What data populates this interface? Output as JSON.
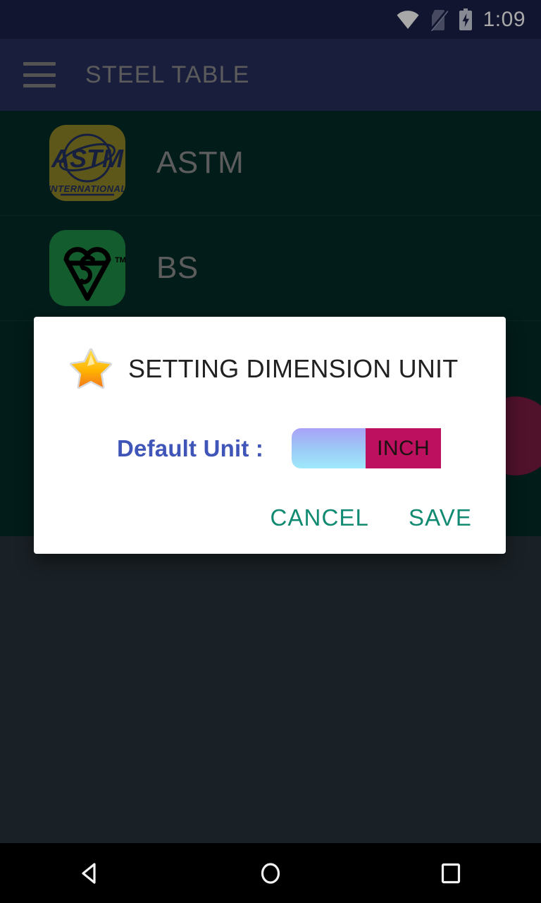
{
  "status_bar": {
    "time": "1:09",
    "icons": [
      {
        "name": "wifi-icon",
        "label": "wifi"
      },
      {
        "name": "no-sim-icon",
        "label": "no-sim"
      },
      {
        "name": "battery-charging-icon",
        "label": "battery-charging"
      }
    ],
    "background_color": "#1b2048"
  },
  "app_bar": {
    "menu_icon": "hamburger-menu-icon",
    "title": "STEEL TABLE",
    "background_color": "#262e5c",
    "title_color": "#8a8a8a"
  },
  "list": {
    "background_color": "#042b28",
    "items": [
      {
        "label": "ASTM",
        "logo_name": "astm-international-logo",
        "logo_text": "ASTM",
        "logo_subtext": "INTERNATIONAL",
        "logo_color": "#8e8426"
      },
      {
        "label": "BS",
        "logo_name": "bsi-kitemark-logo",
        "logo_text": "",
        "logo_subtext": "TM",
        "logo_color": "#1e8c46"
      }
    ]
  },
  "fab": {
    "name": "floating-action-button",
    "color": "#7a1c42"
  },
  "dialog": {
    "icon": "star-icon",
    "title": "SETTING DIMENSION UNIT",
    "field": {
      "label": "Default Unit :",
      "switch_name": "default-unit-toggle",
      "value": "INCH",
      "on_color": "#bd1160",
      "off_color": "#a9a2f7"
    },
    "buttons": {
      "cancel": "CANCEL",
      "save": "SAVE",
      "color": "#118a72"
    },
    "background_color": "#ffffff"
  },
  "nav_bar": {
    "background_color": "#000000",
    "buttons": [
      {
        "name": "nav-back-button",
        "label": "back"
      },
      {
        "name": "nav-home-button",
        "label": "home"
      },
      {
        "name": "nav-recents-button",
        "label": "recents"
      }
    ]
  }
}
